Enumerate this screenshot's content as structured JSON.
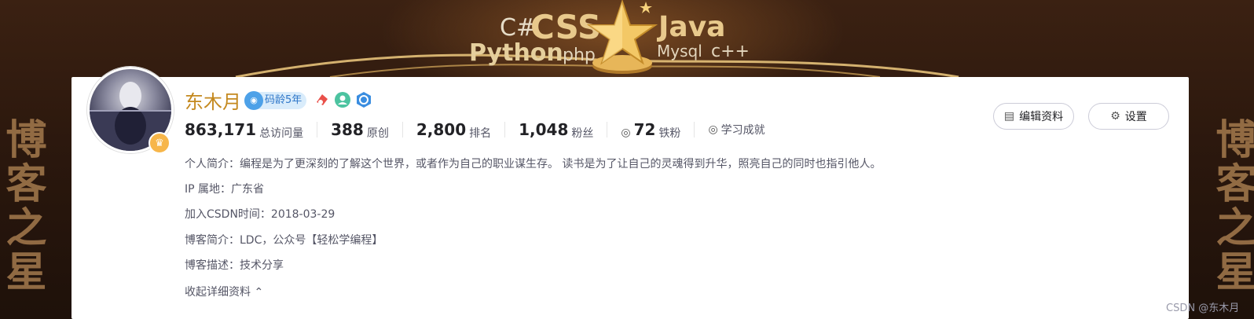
{
  "banner": {
    "tech_cs": "C#",
    "tech_css": "CSS",
    "tech_java": "Java",
    "tech_python": "Python",
    "tech_php": "php",
    "tech_mysql": "Mysql",
    "tech_cpp": "c++",
    "side_text": "博客之星"
  },
  "profile": {
    "username": "东木月",
    "code_age": "码龄5年",
    "badges": [
      "achievement-badge-icon",
      "community-badge-icon",
      "certified-badge-icon"
    ]
  },
  "stats": [
    {
      "value": "863,171",
      "label": "总访问量"
    },
    {
      "value": "388",
      "label": "原创"
    },
    {
      "value": "2,800",
      "label": "排名"
    },
    {
      "value": "1,048",
      "label": "粉丝"
    },
    {
      "value": "72",
      "label": "铁粉"
    },
    {
      "value": "",
      "label": "学习成就"
    }
  ],
  "info": {
    "intro": "个人简介：编程是为了更深刻的了解这个世界，或者作为自己的职业谋生存。 读书是为了让自己的灵魂得到升华，照亮自己的同时也指引他人。",
    "ip": "IP 属地：广东省",
    "joined": "加入CSDN时间：2018-03-29",
    "blog_intro": "博客简介：LDC，公众号【轻松学编程】",
    "blog_desc": "博客描述：技术分享",
    "collapse": "收起详细资料"
  },
  "actions": {
    "edit": "编辑资料",
    "settings": "设置"
  },
  "watermark": "CSDN @东木月"
}
